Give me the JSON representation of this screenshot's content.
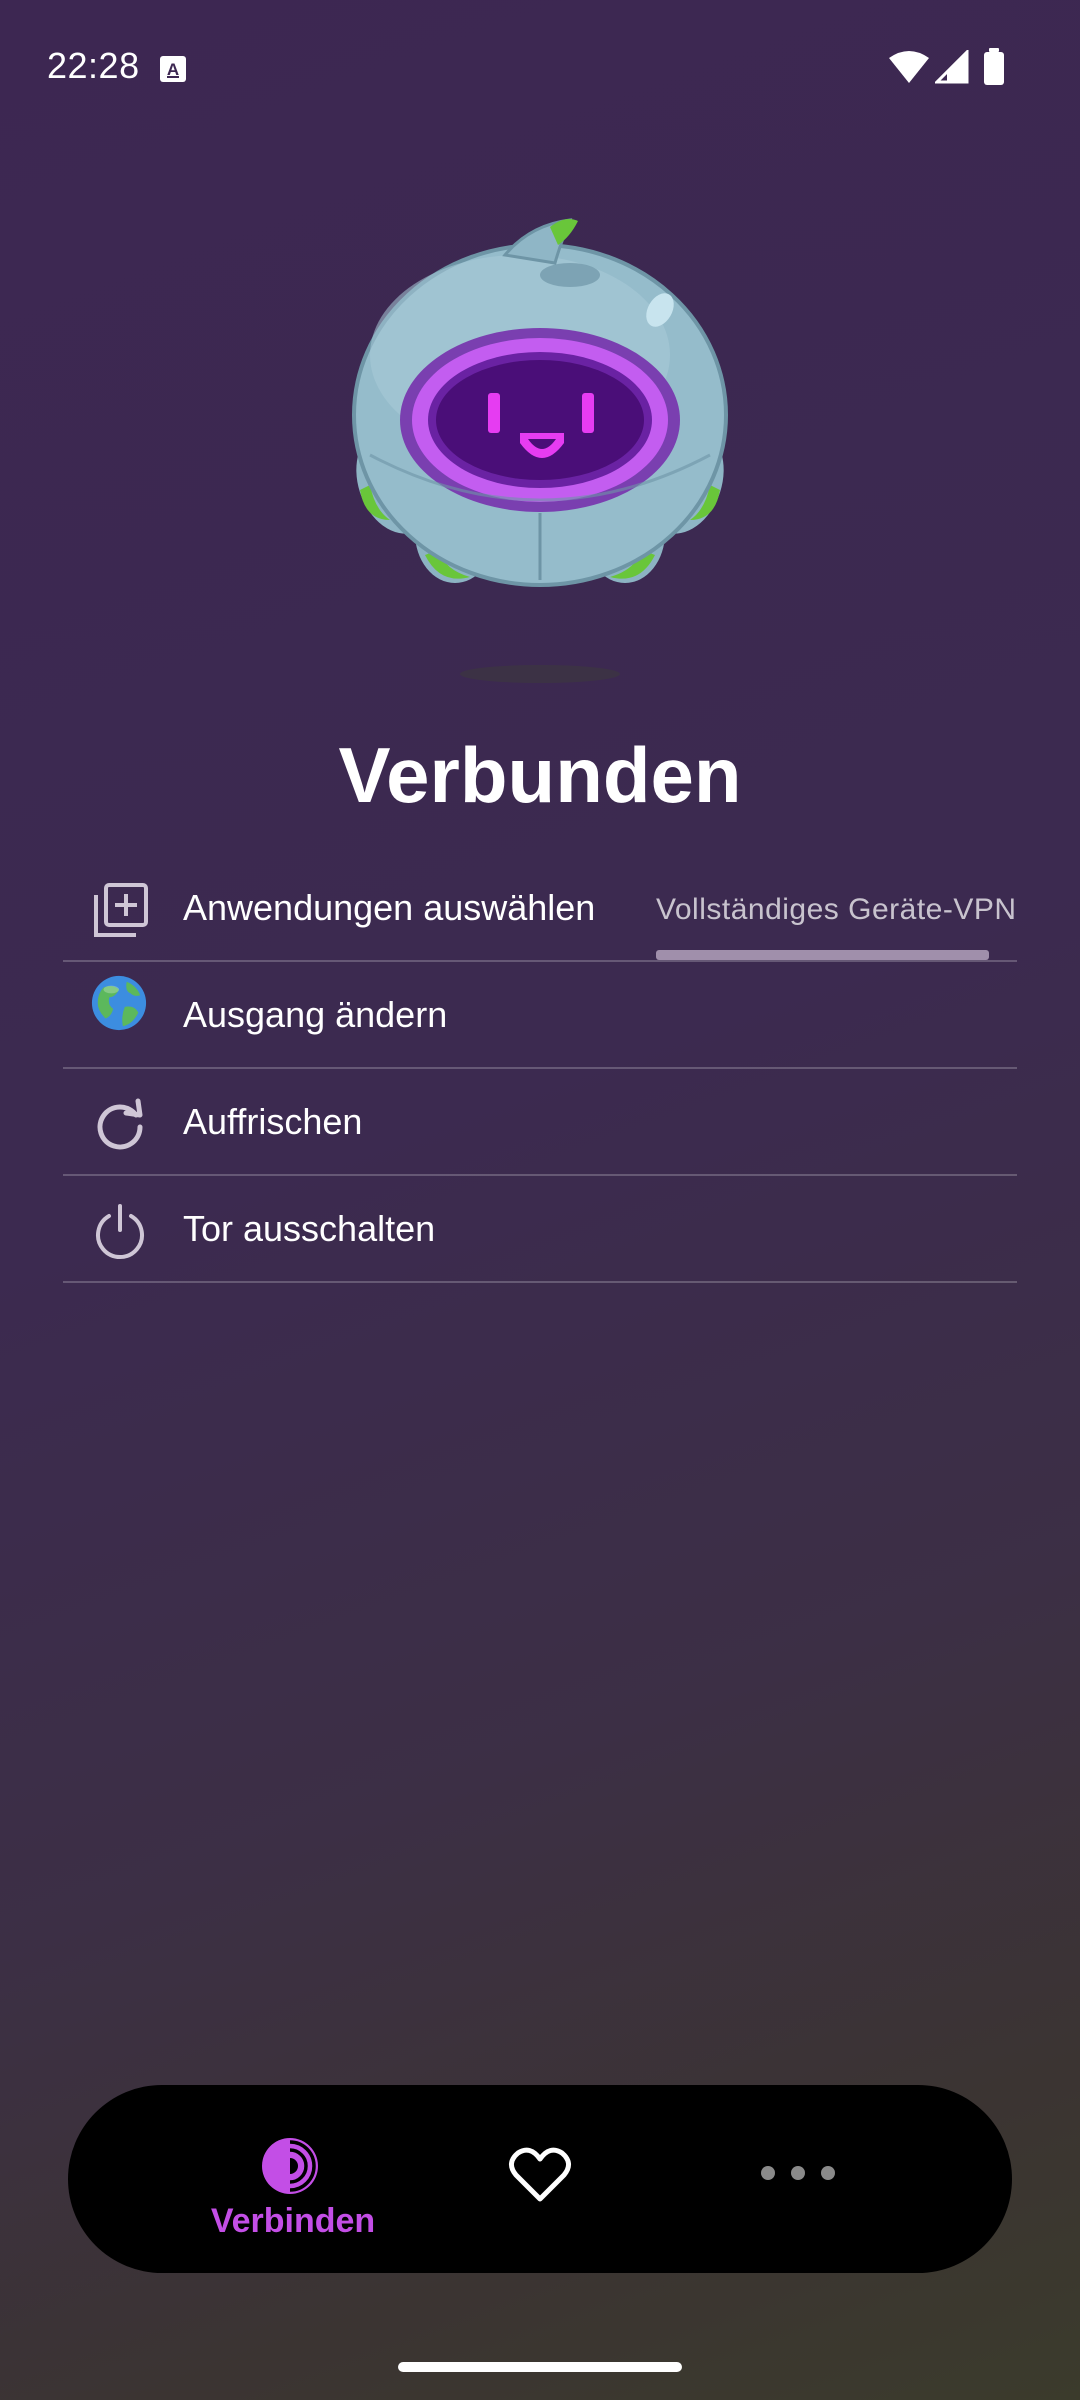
{
  "status_bar": {
    "time": "22:28",
    "icons": [
      "keyboard-a-icon",
      "wifi-icon",
      "cellular-signal-icon",
      "battery-icon"
    ]
  },
  "main": {
    "mascot_icon": "onion-robot-mascot",
    "connection_status": "Verbunden"
  },
  "menu": {
    "items": [
      {
        "label": "Anwendungen auswählen",
        "icon": "add-to-library-icon",
        "tab_label": "Vollständiges Geräte-VPN"
      },
      {
        "label": "Ausgang ändern",
        "icon": "globe-icon"
      },
      {
        "label": "Auffrischen",
        "icon": "refresh-icon"
      },
      {
        "label": "Tor ausschalten",
        "icon": "power-icon"
      }
    ]
  },
  "bottom_nav": {
    "connect_label": "Verbinden",
    "connect_icon": "tor-onion-icon",
    "favorites_icon": "heart-icon",
    "more_icon": "more-dots-icon"
  },
  "colors": {
    "accent": "#c34ee6",
    "background_top": "#3d2752",
    "background_bottom": "#3b3b2c",
    "nav_background": "#000000"
  }
}
